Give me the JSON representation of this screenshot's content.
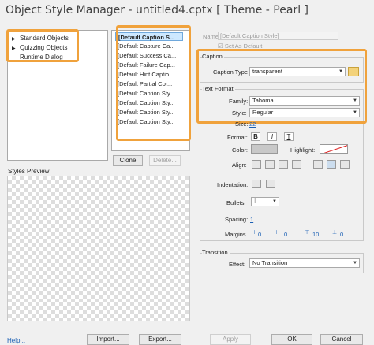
{
  "window": {
    "title": "Object Style Manager - untitled4.cptx [ Theme - Pearl ]"
  },
  "tree": {
    "items": [
      {
        "label": "Standard Objects",
        "expandable": true
      },
      {
        "label": "Quizzing Objects",
        "expandable": true
      },
      {
        "label": "Runtime Dialog",
        "expandable": false
      }
    ]
  },
  "styles_list": {
    "items": [
      "[Default Caption S...",
      "[Default Capture Ca...",
      "[Default Success Ca...",
      "[Default Failure Cap...",
      "[Default Hint Captio...",
      "[Default Partial Cor...",
      "[Default Caption Sty...",
      "[Default Caption Sty...",
      "[Default Caption Sty...",
      "[Default Caption Sty..."
    ],
    "clone_label": "Clone",
    "delete_label": "Delete..."
  },
  "preview": {
    "label": "Styles Preview"
  },
  "props": {
    "name_label": "Name",
    "name_value": "[Default Caption Style]",
    "set_default_label": "Set As Default",
    "caption": {
      "group_label": "Caption",
      "type_label": "Caption Type",
      "type_value": "transparent"
    },
    "text_format": {
      "group_label": "Text Format",
      "family_label": "Family:",
      "family_value": "Tahoma",
      "style_label": "Style:",
      "style_value": "Regular",
      "size_label": "Size:",
      "size_value": "22",
      "format_label": "Format:",
      "bold": "B",
      "italic": "I",
      "underline": "T",
      "color_label": "Color:",
      "highlight_label": "Highlight:",
      "align_label": "Align:",
      "indentation_label": "Indentation:",
      "bullets_label": "Bullets:",
      "spacing_label": "Spacing:",
      "spacing_value": "1",
      "margins_label": "Margins",
      "margins": [
        "0",
        "0",
        "10",
        "0"
      ]
    },
    "transition": {
      "group_label": "Transition",
      "effect_label": "Effect:",
      "effect_value": "No Transition"
    }
  },
  "footer": {
    "help": "Help...",
    "import": "Import...",
    "export": "Export...",
    "apply": "Apply",
    "ok": "OK",
    "cancel": "Cancel"
  },
  "colors": {
    "accent_highlight": "#f0a23c",
    "selection": "#cde8ff",
    "link": "#1a5fb4"
  }
}
